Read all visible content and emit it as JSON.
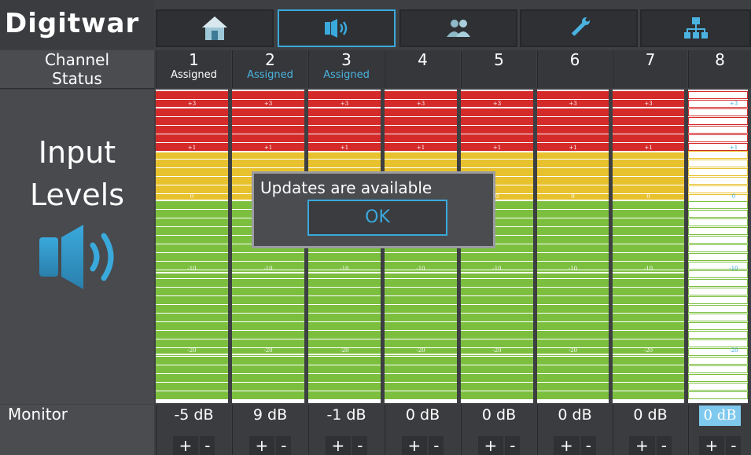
{
  "app": {
    "logo_text": "Digitwar"
  },
  "nav": [
    {
      "icon": "home-icon"
    },
    {
      "icon": "speaker-icon",
      "active": true
    },
    {
      "icon": "users-icon"
    },
    {
      "icon": "wrench-icon"
    },
    {
      "icon": "network-icon"
    }
  ],
  "header": {
    "channel_label": "Channel",
    "status_label": "Status"
  },
  "left_panel": {
    "title_line1": "Input",
    "title_line2": "Levels",
    "icon": "speaker-icon"
  },
  "channels": [
    {
      "number": "1",
      "status": "Assigned",
      "monitor": "-5 dB"
    },
    {
      "number": "2",
      "status": "Assigned",
      "monitor": "9 dB"
    },
    {
      "number": "3",
      "status": "Assigned",
      "monitor": "-1 dB"
    },
    {
      "number": "4",
      "status": "",
      "monitor": "0 dB"
    },
    {
      "number": "5",
      "status": "",
      "monitor": "0 dB"
    },
    {
      "number": "6",
      "status": "",
      "monitor": "0 dB"
    },
    {
      "number": "7",
      "status": "",
      "monitor": "0 dB"
    },
    {
      "number": "8",
      "status": "",
      "monitor": "0 dB"
    }
  ],
  "meter_scale": [
    "+3",
    "+1",
    "0",
    "-10",
    "-20"
  ],
  "monitor": {
    "label": "Monitor",
    "plus": "+",
    "minus": "-"
  },
  "dialog": {
    "message": "Updates are available",
    "ok_label": "OK"
  },
  "colors": {
    "accent": "#3aa9dc",
    "red": "#d42a2a",
    "yellow": "#e8c22e",
    "green": "#7cbf3f"
  }
}
